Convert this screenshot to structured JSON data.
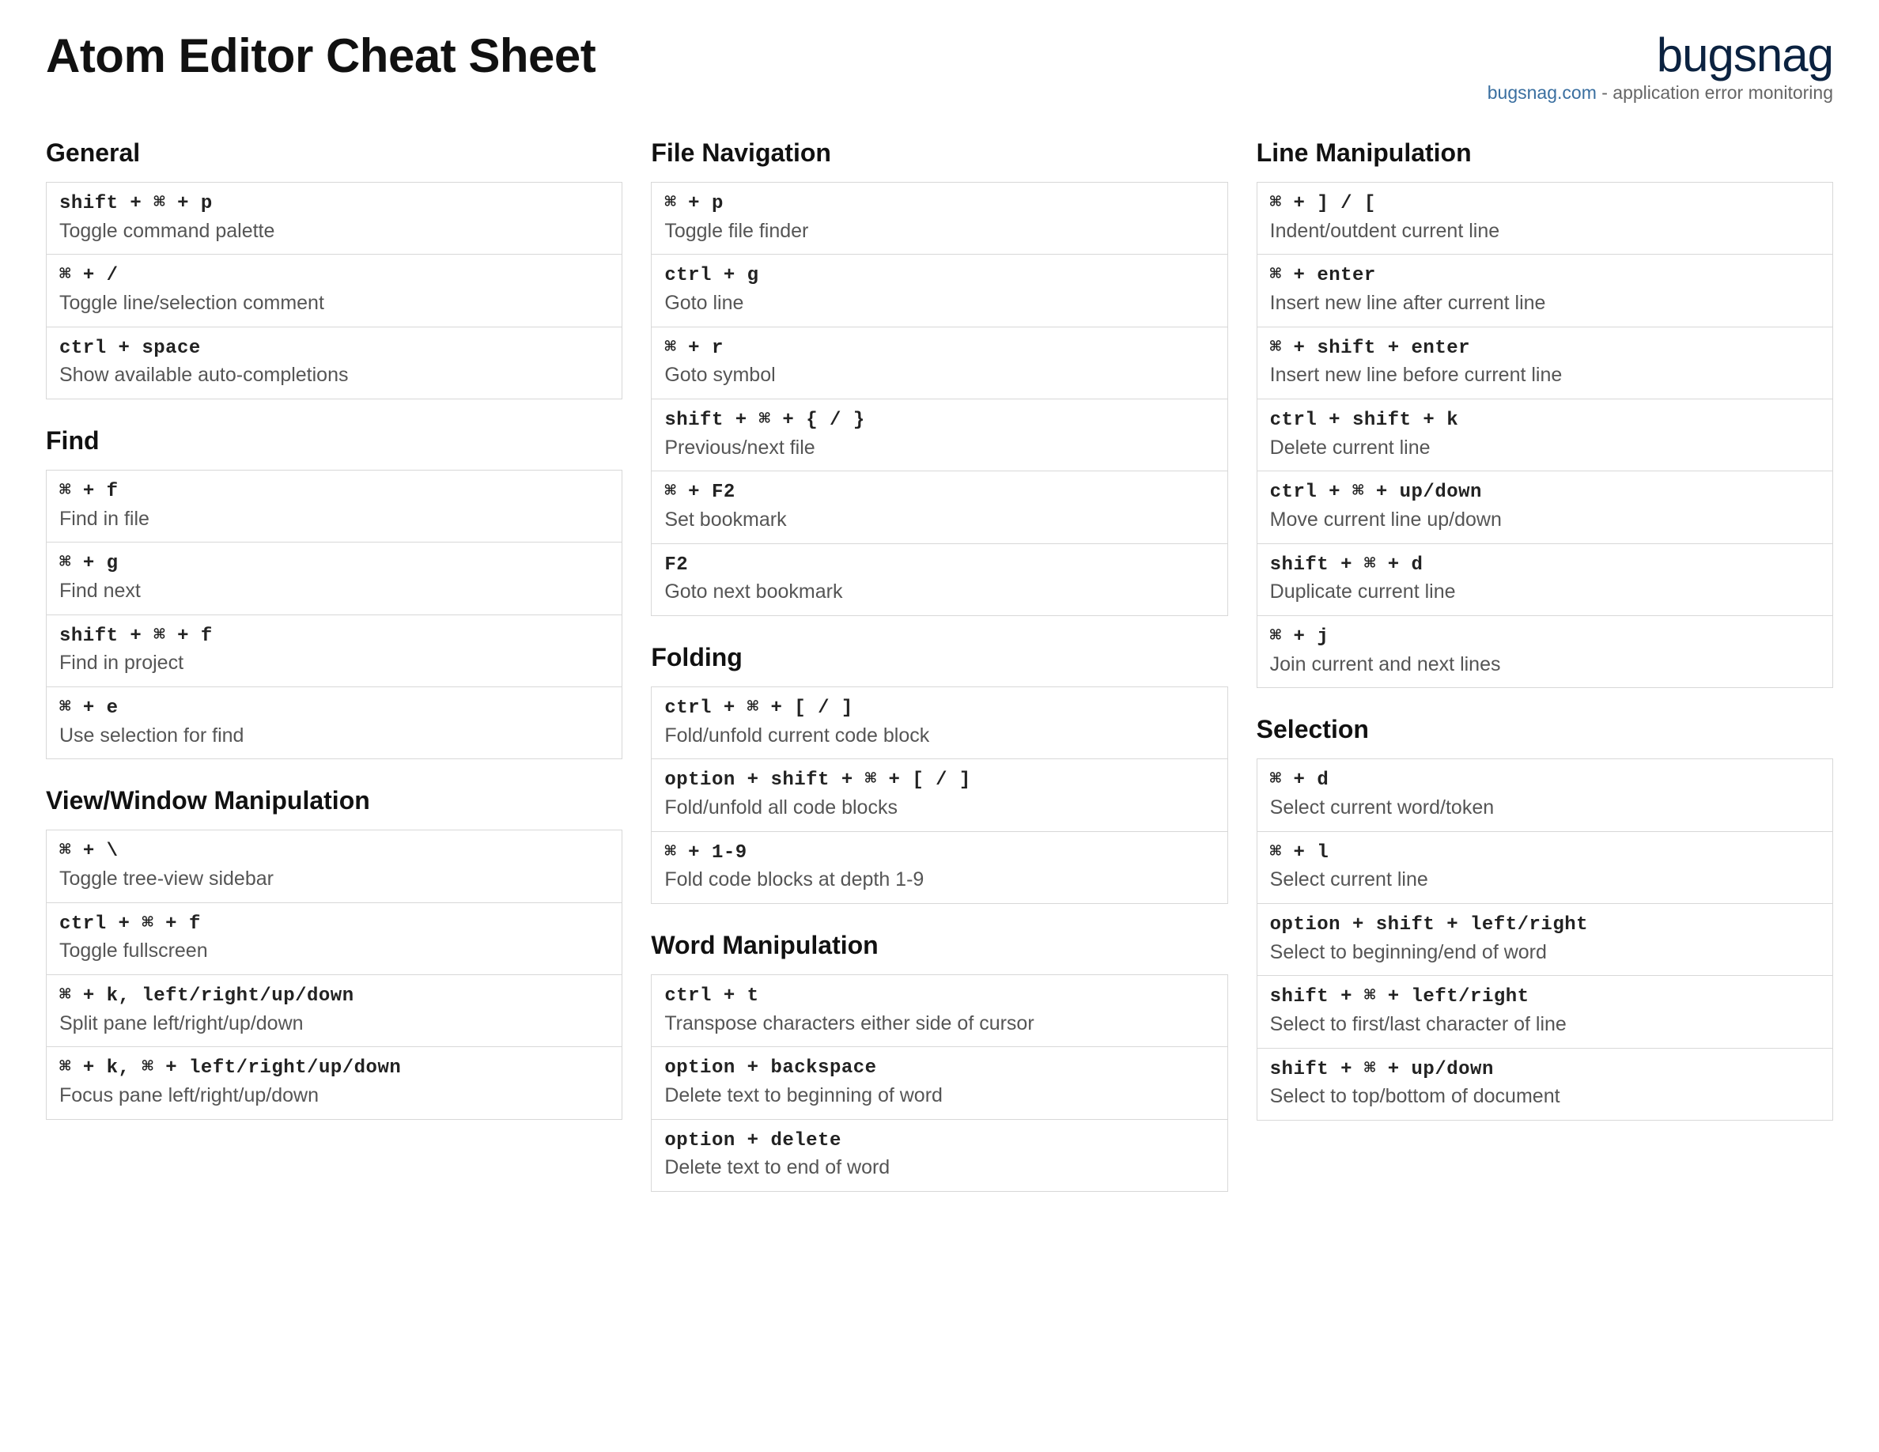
{
  "header": {
    "title": "Atom Editor Cheat Sheet",
    "brand_logo": "bugsnag",
    "brand_link": "bugsnag.com",
    "brand_tagline_rest": " - application error monitoring"
  },
  "columns": [
    {
      "sections": [
        {
          "title": "General",
          "rows": [
            {
              "shortcut": "shift + ⌘ + p",
              "desc": "Toggle command palette"
            },
            {
              "shortcut": "⌘ + /",
              "desc": "Toggle line/selection comment"
            },
            {
              "shortcut": "ctrl + space",
              "desc": "Show available auto-completions"
            }
          ]
        },
        {
          "title": "Find",
          "rows": [
            {
              "shortcut": "⌘ + f",
              "desc": "Find in file"
            },
            {
              "shortcut": "⌘ + g",
              "desc": "Find next"
            },
            {
              "shortcut": "shift + ⌘ + f",
              "desc": "Find in project"
            },
            {
              "shortcut": "⌘ + e",
              "desc": "Use selection for find"
            }
          ]
        },
        {
          "title": "View/Window Manipulation",
          "rows": [
            {
              "shortcut": "⌘ + \\",
              "desc": "Toggle tree-view sidebar"
            },
            {
              "shortcut": "ctrl + ⌘ + f",
              "desc": "Toggle fullscreen"
            },
            {
              "shortcut": "⌘ + k, left/right/up/down",
              "desc": "Split pane left/right/up/down"
            },
            {
              "shortcut": "⌘ + k, ⌘ + left/right/up/down",
              "desc": "Focus pane left/right/up/down"
            }
          ]
        }
      ]
    },
    {
      "sections": [
        {
          "title": "File Navigation",
          "rows": [
            {
              "shortcut": "⌘ + p",
              "desc": "Toggle file finder"
            },
            {
              "shortcut": "ctrl + g",
              "desc": "Goto line"
            },
            {
              "shortcut": "⌘ + r",
              "desc": "Goto symbol"
            },
            {
              "shortcut": "shift + ⌘ + { / }",
              "desc": "Previous/next file"
            },
            {
              "shortcut": "⌘ + F2",
              "desc": "Set bookmark"
            },
            {
              "shortcut": "F2",
              "desc": "Goto next bookmark"
            }
          ]
        },
        {
          "title": "Folding",
          "rows": [
            {
              "shortcut": "ctrl + ⌘ + [ / ]",
              "desc": "Fold/unfold current code block"
            },
            {
              "shortcut": "option + shift + ⌘ + [ / ]",
              "desc": "Fold/unfold all code blocks"
            },
            {
              "shortcut": "⌘ + 1-9",
              "desc": "Fold code blocks at depth 1-9"
            }
          ]
        },
        {
          "title": "Word Manipulation",
          "rows": [
            {
              "shortcut": "ctrl + t",
              "desc": "Transpose characters either side of cursor"
            },
            {
              "shortcut": "option + backspace",
              "desc": "Delete text to beginning of word"
            },
            {
              "shortcut": "option + delete",
              "desc": "Delete text to end of word"
            }
          ]
        }
      ]
    },
    {
      "sections": [
        {
          "title": "Line Manipulation",
          "rows": [
            {
              "shortcut": "⌘ + ] / [",
              "desc": "Indent/outdent current line"
            },
            {
              "shortcut": "⌘ + enter",
              "desc": "Insert new line after current line"
            },
            {
              "shortcut": "⌘ + shift + enter",
              "desc": "Insert new line before current line"
            },
            {
              "shortcut": "ctrl + shift + k",
              "desc": "Delete current line"
            },
            {
              "shortcut": "ctrl + ⌘ + up/down",
              "desc": "Move current line up/down"
            },
            {
              "shortcut": "shift + ⌘ + d",
              "desc": "Duplicate current line"
            },
            {
              "shortcut": "⌘ + j",
              "desc": "Join current and next lines"
            }
          ]
        },
        {
          "title": "Selection",
          "rows": [
            {
              "shortcut": "⌘ + d",
              "desc": "Select current word/token"
            },
            {
              "shortcut": "⌘ + l",
              "desc": "Select current line"
            },
            {
              "shortcut": "option + shift + left/right",
              "desc": "Select to beginning/end of word"
            },
            {
              "shortcut": "shift + ⌘ + left/right",
              "desc": "Select to first/last character of line"
            },
            {
              "shortcut": "shift + ⌘ + up/down",
              "desc": "Select to top/bottom of document"
            }
          ]
        }
      ]
    }
  ]
}
